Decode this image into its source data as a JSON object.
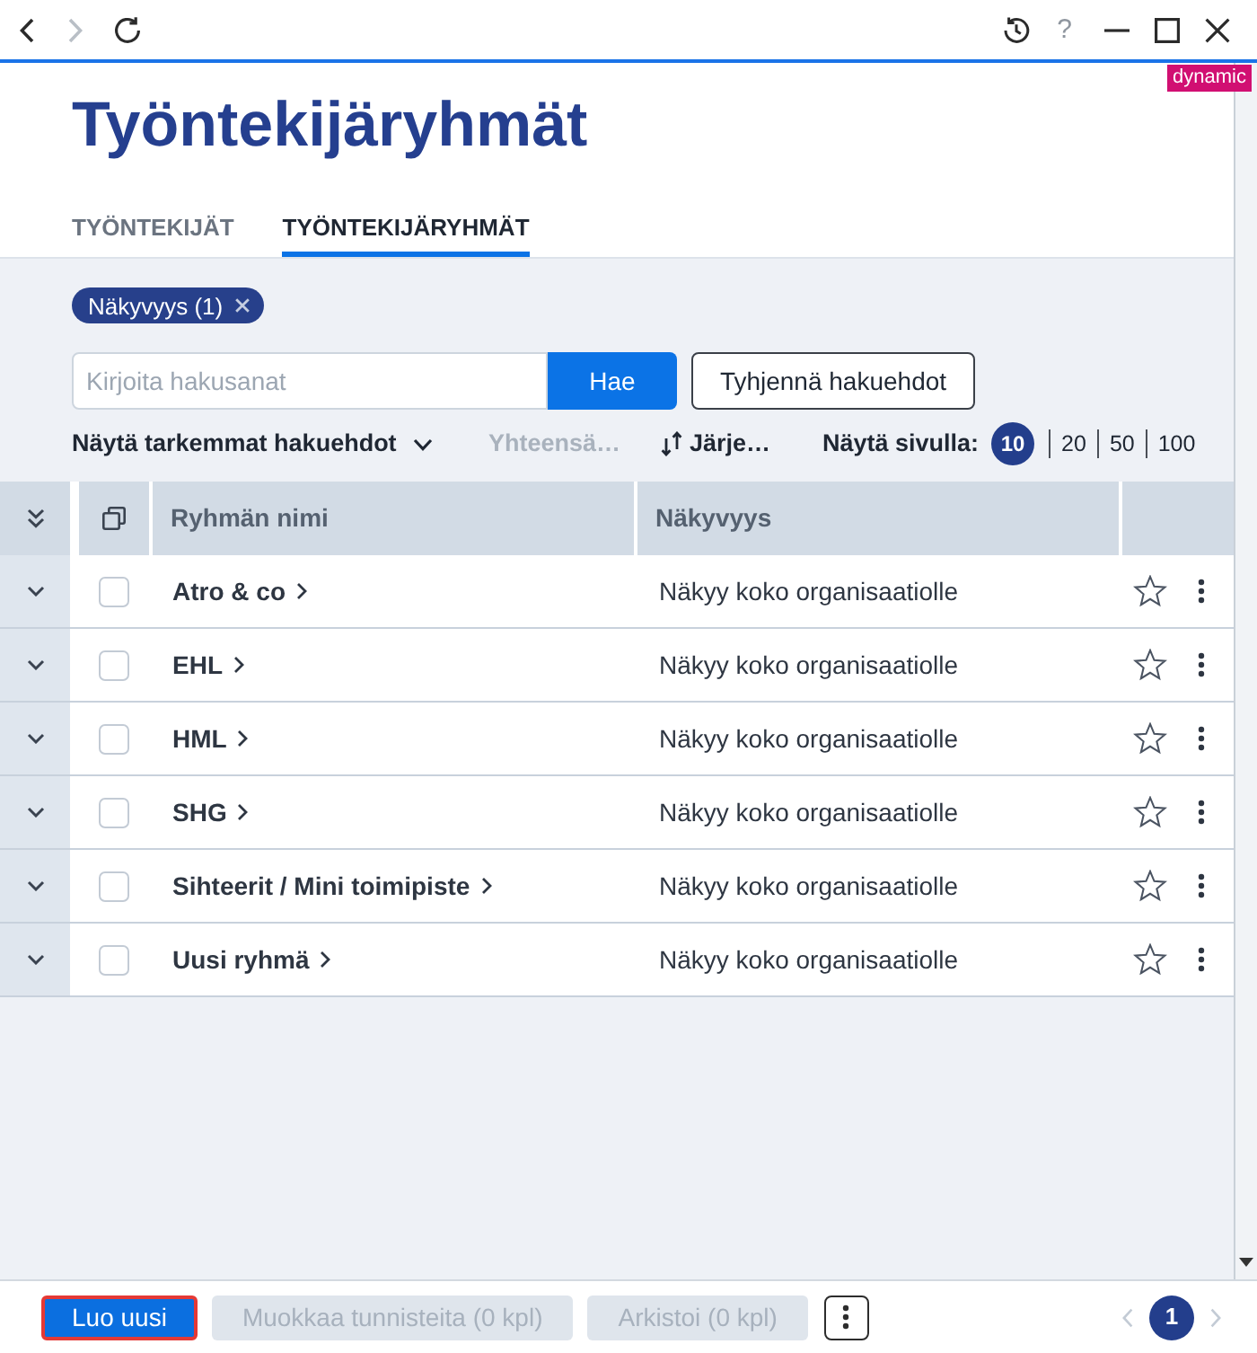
{
  "browser_bar": {
    "nav_buttons": [
      {
        "kind": "back",
        "disabled": false
      },
      {
        "kind": "forward",
        "disabled": true
      },
      {
        "kind": "reload",
        "disabled": false
      }
    ],
    "window_buttons": [
      {
        "kind": "history",
        "disabled": false
      },
      {
        "kind": "help",
        "label": "?",
        "disabled": true
      },
      {
        "kind": "minimize",
        "disabled": false
      },
      {
        "kind": "maximize",
        "disabled": false
      },
      {
        "kind": "close",
        "disabled": false
      }
    ]
  },
  "badge": "dynamic",
  "page": {
    "title": "Työntekijäryhmät",
    "tabs": [
      {
        "label": "TYÖNTEKIJÄT",
        "selected": false
      },
      {
        "label": "TYÖNTEKIJÄRYHMÄT",
        "selected": true
      }
    ]
  },
  "filters": {
    "chips": [
      {
        "label": "Näkyvyys (1)"
      }
    ],
    "search": {
      "placeholder": "Kirjoita hakusanat",
      "button": "Hae"
    },
    "clear_button": "Tyhjennä hakuehdot"
  },
  "options": {
    "advanced": {
      "label": "Näytä tarkemmat hakuehdot",
      "expanded": false
    },
    "total": {
      "label": "Yhteensä…",
      "disabled": true
    },
    "sort": {
      "label": "Järje…"
    },
    "page_size": {
      "label": "Näytä sivulla:",
      "options": [
        {
          "label": "10",
          "selected": true
        },
        {
          "label": "20",
          "selected": false
        },
        {
          "label": "50",
          "selected": false
        },
        {
          "label": "100",
          "selected": false
        }
      ]
    }
  },
  "table": {
    "columns": [
      {
        "label": "Ryhmän nimi"
      },
      {
        "label": "Näkyvyys"
      }
    ],
    "rows": [
      {
        "name": "Atro & co",
        "visibility": "Näkyy koko organisaatiolle",
        "checked": false,
        "starred": false,
        "expanded": false
      },
      {
        "name": "EHL",
        "visibility": "Näkyy koko organisaatiolle",
        "checked": false,
        "starred": false,
        "expanded": false
      },
      {
        "name": "HML",
        "visibility": "Näkyy koko organisaatiolle",
        "checked": false,
        "starred": false,
        "expanded": false
      },
      {
        "name": "SHG",
        "visibility": "Näkyy koko organisaatiolle",
        "checked": false,
        "starred": false,
        "expanded": false
      },
      {
        "name": "Sihteerit / Mini toimipiste",
        "visibility": "Näkyy koko organisaatiolle",
        "checked": false,
        "starred": false,
        "expanded": false
      },
      {
        "name": "Uusi ryhmä",
        "visibility": "Näkyy koko organisaatiolle",
        "checked": false,
        "starred": false,
        "expanded": false
      }
    ]
  },
  "footer": {
    "buttons": [
      {
        "label": "Luo uusi",
        "kind": "primary",
        "disabled": false,
        "focused": true
      },
      {
        "label": "Muokkaa tunnisteita (0 kpl)",
        "kind": "secondary",
        "disabled": true,
        "focused": false
      },
      {
        "label": "Arkistoi (0 kpl)",
        "kind": "secondary",
        "disabled": true,
        "focused": false
      }
    ],
    "pager": {
      "previous": {
        "disabled": true
      },
      "pages": [
        {
          "label": "1",
          "selected": true
        }
      ],
      "next": {
        "disabled": true
      }
    }
  }
}
